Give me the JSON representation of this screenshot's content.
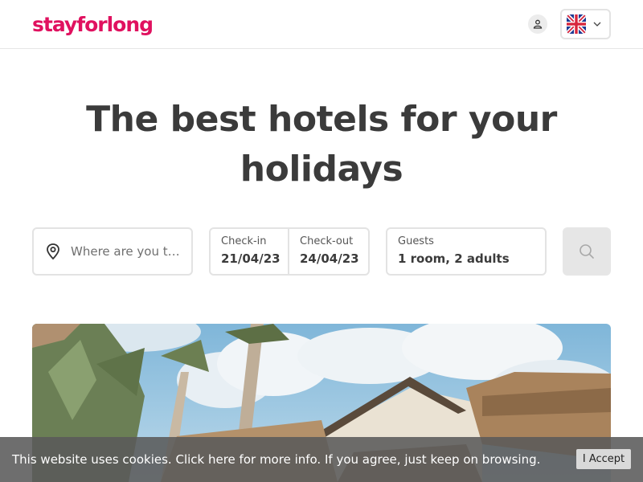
{
  "header": {
    "logo_text": "stayforlong",
    "brand_color": "#e0115f",
    "user_icon": "user-icon",
    "language_flag": "uk-flag-icon",
    "language_chevron": "chevron-down-icon"
  },
  "hero": {
    "title": "The best hotels for your holidays"
  },
  "search": {
    "destination_placeholder": "Where are you tra…",
    "destination_icon": "location-pin-icon",
    "checkin_label": "Check-in",
    "checkin_value": "21/04/23",
    "checkout_label": "Check-out",
    "checkout_value": "24/04/23",
    "guests_label": "Guests",
    "guests_value": "1 room, 2 adults",
    "search_icon": "search-icon"
  },
  "cookie": {
    "message": "This website uses cookies. Click here for more info. If you agree, just keep on browsing.",
    "accept_label": "I Accept"
  }
}
